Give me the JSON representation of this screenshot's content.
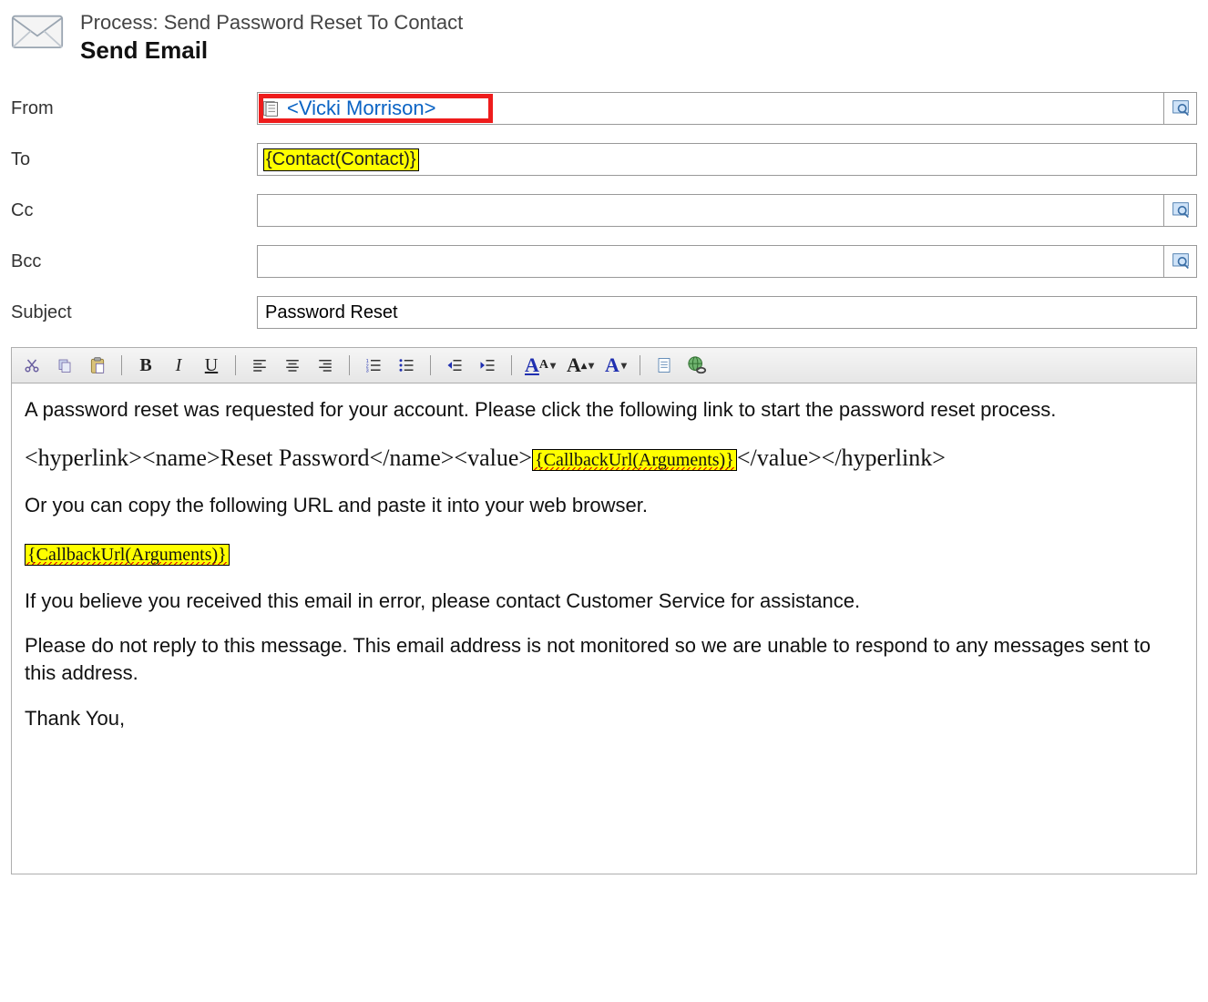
{
  "header": {
    "process_line": "Process: Send Password Reset To Contact",
    "title": "Send Email"
  },
  "labels": {
    "from": "From",
    "to": "To",
    "cc": "Cc",
    "bcc": "Bcc",
    "subject": "Subject"
  },
  "fields": {
    "from_display": "<Vicki Morrison>",
    "to_token": "{Contact(Contact)}",
    "cc": "",
    "bcc": "",
    "subject": "Password Reset"
  },
  "toolbar": {
    "cut": "cut-icon",
    "copy": "copy-icon",
    "paste": "paste-icon",
    "bold": "B",
    "italic": "I",
    "underline": "U"
  },
  "body": {
    "p1": "A password reset was requested for your account. Please click the following link to start the password reset process.",
    "link_open": "<hyperlink><name>",
    "link_name": "Reset Password",
    "link_mid": "</name><value>",
    "link_token": "{CallbackUrl(Arguments)}",
    "link_close": "</value></hyperlink>",
    "p3": "Or you can copy the following URL and paste it into your web browser.",
    "url_token": "{CallbackUrl(Arguments)}",
    "p5": "If you believe you received this email in error, please contact Customer Service for assistance.",
    "p6": "Please do not reply to this message. This email address is not monitored so we are unable to respond to any messages sent to this address.",
    "p7": "Thank You,"
  }
}
